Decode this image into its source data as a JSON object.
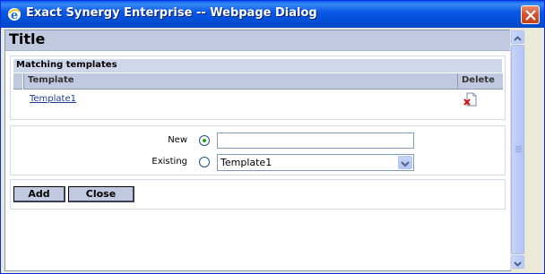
{
  "window": {
    "title": "Exact Synergy Enterprise -- Webpage Dialog"
  },
  "page": {
    "title": "Title"
  },
  "matching_templates": {
    "section_title": "Matching templates",
    "columns": [
      "Template",
      "Delete"
    ],
    "rows": [
      {
        "template": "Template1",
        "delete_icon": "delete-document-icon"
      }
    ]
  },
  "form": {
    "new_label": "New",
    "new_value": "",
    "new_selected": true,
    "existing_label": "Existing",
    "existing_selected": false,
    "existing_value": "Template1"
  },
  "buttons": {
    "add": "Add",
    "close": "Close"
  },
  "colors": {
    "titlebar": "#0351d8",
    "header_bg": "#c1c9e0",
    "link": "#1f3a93"
  }
}
